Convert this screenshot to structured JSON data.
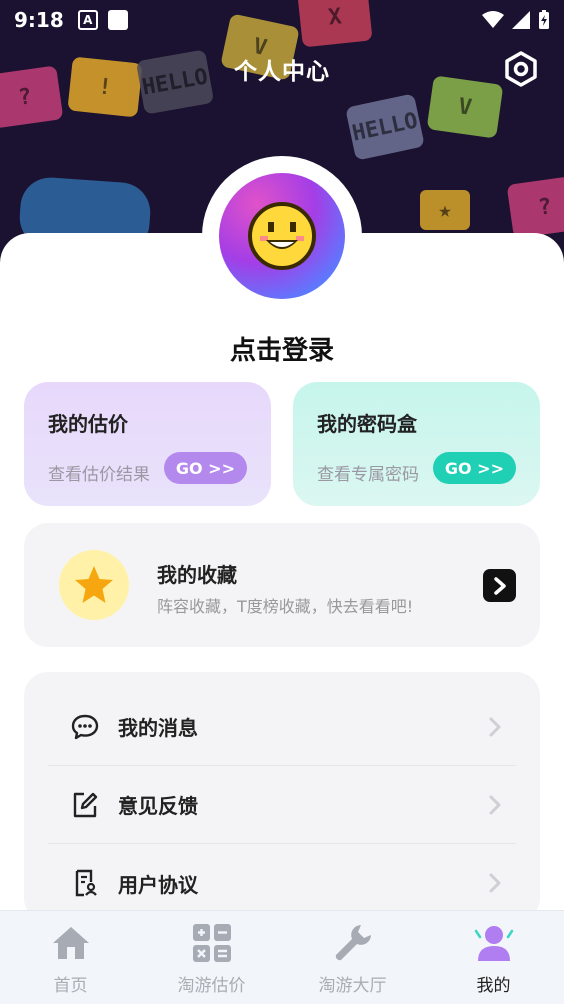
{
  "status_bar": {
    "time": "9:18",
    "notif_icon_letter": "A"
  },
  "header": {
    "title": "个人中心"
  },
  "profile": {
    "login_label": "点击登录"
  },
  "cards": {
    "estimate": {
      "title": "我的估价",
      "subtitle": "查看估价结果",
      "go_label": "GO >>"
    },
    "password_box": {
      "title": "我的密码盒",
      "subtitle": "查看专属密码",
      "go_label": "GO >>"
    }
  },
  "favorites": {
    "title": "我的收藏",
    "subtitle": "阵容收藏，T度榜收藏，快去看看吧!"
  },
  "menu": {
    "items": [
      {
        "label": "我的消息",
        "icon": "chat-bubble-icon"
      },
      {
        "label": "意见反馈",
        "icon": "edit-note-icon"
      },
      {
        "label": "用户协议",
        "icon": "user-document-icon"
      }
    ]
  },
  "tabbar": {
    "tabs": [
      {
        "label": "首页",
        "icon": "home-icon",
        "active": false
      },
      {
        "label": "淘游估价",
        "icon": "calculator-icon",
        "active": false
      },
      {
        "label": "淘游大厅",
        "icon": "wrench-icon",
        "active": false
      },
      {
        "label": "我的",
        "icon": "profile-icon",
        "active": true
      }
    ]
  },
  "colors": {
    "hero_bg": "#1a1230",
    "estimate_go": "#b489ee",
    "password_go": "#1fd0b5",
    "active_tab": "#b07ef0"
  }
}
